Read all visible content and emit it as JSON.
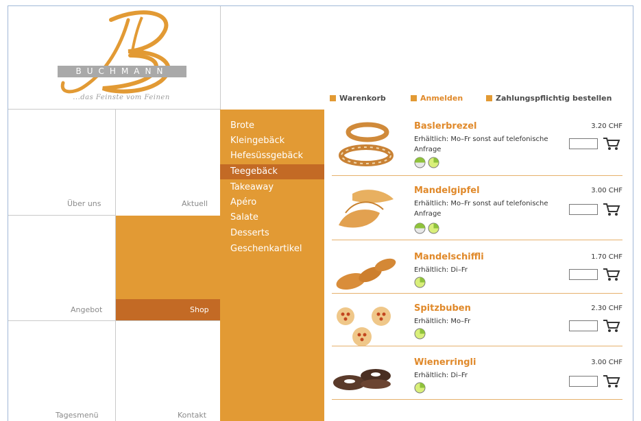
{
  "brand": {
    "name": "BUCHMANN",
    "tagline": "...das Feinste vom Feinen"
  },
  "colors": {
    "accent": "#e29a34",
    "accent_dark": "#c36a25",
    "product_name": "#e0892a"
  },
  "topnav": [
    {
      "label": "Warenkorb"
    },
    {
      "label": "Anmelden"
    },
    {
      "label": "Zahlungspflichtig bestellen"
    }
  ],
  "tiles": {
    "ueber_uns": "Über uns",
    "aktuell": "Aktuell",
    "angebot": "Angebot",
    "shop": "Shop",
    "tagesmenue": "Tagesmenü",
    "kontakt": "Kontakt"
  },
  "categories": [
    {
      "label": "Brote"
    },
    {
      "label": "Kleingebäck"
    },
    {
      "label": "Hefesüssgebäck"
    },
    {
      "label": "Teegebäck"
    },
    {
      "label": "Takeaway"
    },
    {
      "label": "Apéro"
    },
    {
      "label": "Salate"
    },
    {
      "label": "Desserts"
    },
    {
      "label": "Geschenkartikel"
    }
  ],
  "products": [
    {
      "name": "Baslerbrezel",
      "availability": "Erhältlich: Mo–Fr sonst auf telefonische Anfrage",
      "price": "3.20 CHF",
      "icon": "pretzel"
    },
    {
      "name": "Mandelgipfel",
      "availability": "Erhältlich: Mo–Fr sonst auf telefonische Anfrage",
      "price": "3.00 CHF",
      "icon": "croissant"
    },
    {
      "name": "Mandelschiffli",
      "availability": "Erhältlich: Di–Fr",
      "price": "1.70 CHF",
      "icon": "almond-boat"
    },
    {
      "name": "Spitzbuben",
      "availability": "Erhältlich: Mo–Fr",
      "price": "2.30 CHF",
      "icon": "jam-cookie"
    },
    {
      "name": "Wienerringli",
      "availability": "Erhältlich: Di–Fr",
      "price": "3.00 CHF",
      "icon": "chocolate-ring"
    }
  ]
}
